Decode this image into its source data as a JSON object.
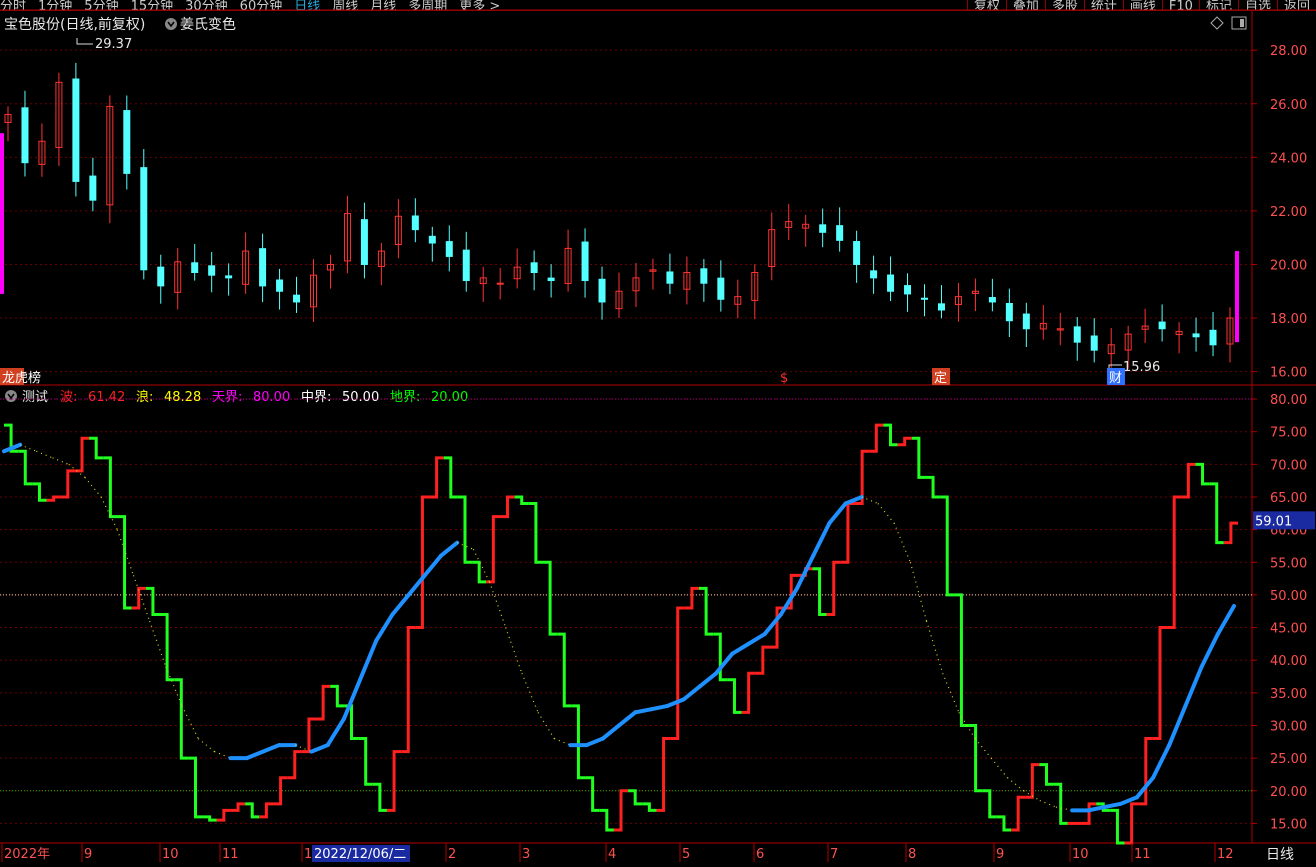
{
  "toolbar": {
    "left_items": [
      "分时",
      "1分钟",
      "5分钟",
      "15分钟",
      "30分钟",
      "60分钟",
      "日线",
      "周线",
      "月线",
      "多周期",
      "更多 >"
    ],
    "active_item": "日线",
    "right_items": [
      "复权",
      "叠加",
      "多股",
      "统计",
      "画线",
      "F10",
      "标记",
      "自选",
      "返回"
    ]
  },
  "price_panel": {
    "title": "宝色股份(日线,前复权)",
    "indicator_name": "姜氏变色",
    "high_label": "29.37",
    "low_label": "15.96",
    "y_ticks": [
      "28.00",
      "26.00",
      "24.00",
      "22.00",
      "20.00",
      "18.00",
      "16.00"
    ],
    "y_values": [
      28,
      26,
      24,
      22,
      20,
      18,
      16
    ],
    "markers": [
      {
        "text": "龙虎榜",
        "color": "#d04020"
      },
      {
        "text": "$",
        "color": "#ff3030"
      },
      {
        "text": "定",
        "color": "#d04020"
      },
      {
        "text": "财",
        "color": "#3070ff"
      }
    ],
    "colors": {
      "up": "#ff3232",
      "down": "#54ffff",
      "accent": "#ff00ff"
    }
  },
  "indicator_panel": {
    "name": "测试",
    "legend": [
      {
        "label": "波:",
        "value": "61.42",
        "color": "#ff2020"
      },
      {
        "label": "浪:",
        "value": "48.28",
        "color": "#ffff00"
      },
      {
        "label": "天界:",
        "value": "80.00",
        "color": "#ff00ff"
      },
      {
        "label": "中界:",
        "value": "50.00",
        "color": "#ffffff"
      },
      {
        "label": "地界:",
        "value": "20.00",
        "color": "#00ff00"
      }
    ],
    "current_value": "59.01",
    "y_ticks": [
      "80.00",
      "75.00",
      "70.00",
      "65.00",
      "60.00",
      "55.00",
      "50.00",
      "45.00",
      "40.00",
      "35.00",
      "30.00",
      "25.00",
      "20.00",
      "15.00"
    ],
    "y_values": [
      80,
      75,
      70,
      65,
      60,
      55,
      50,
      45,
      40,
      35,
      30,
      25,
      20,
      15
    ],
    "level_lines": [
      80,
      50,
      20
    ]
  },
  "x_axis": {
    "labels": [
      "2022年",
      "9",
      "10",
      "11",
      "1",
      "2",
      "3",
      "4",
      "5",
      "6",
      "7",
      "8",
      "9",
      "10",
      "11",
      "12"
    ],
    "cursor_label": "2022/12/06/二",
    "period": "日线"
  },
  "chart_data": [
    {
      "type": "candlestick",
      "title": "宝色股份(日线,前复权)",
      "ylim": [
        15.5,
        29.5
      ],
      "annotations": {
        "high": 29.37,
        "low": 15.96
      },
      "series": [
        {
          "name": "close",
          "values": [
            25.6,
            23.8,
            24.6,
            26.8,
            23.1,
            22.4,
            25.9,
            23.4,
            19.8,
            19.2,
            20.1,
            19.7,
            19.6,
            19.5,
            20.5,
            19.2,
            19.0,
            18.6,
            19.6,
            20.0,
            21.9,
            20.0,
            20.5,
            21.8,
            21.3,
            20.8,
            20.3,
            19.4,
            19.5,
            19.3,
            19.9,
            19.7,
            19.4,
            20.6,
            19.4,
            18.6,
            19.0,
            19.5,
            19.8,
            19.3,
            19.7,
            19.3,
            18.7,
            18.8,
            19.7,
            21.3,
            21.6,
            21.5,
            21.2,
            20.9,
            20.0,
            19.5,
            19.0,
            18.9,
            18.7,
            18.3,
            18.8,
            19.0,
            18.6,
            17.9,
            17.6,
            17.8,
            17.6,
            17.1,
            16.8,
            17.0,
            17.4,
            17.7,
            17.6,
            17.5,
            17.3,
            17.0,
            18.0
          ]
        }
      ]
    },
    {
      "type": "line",
      "title": "测试",
      "ylim": [
        12,
        82
      ],
      "series": [
        {
          "name": "波",
          "values": [
            76,
            72,
            67,
            64.5,
            65,
            69,
            74,
            71,
            62,
            48,
            51,
            47,
            37,
            25,
            16,
            15.5,
            17,
            18,
            16,
            18,
            22,
            26,
            31,
            36,
            33,
            28,
            21,
            17,
            26,
            45,
            65,
            71,
            65,
            55,
            52,
            62,
            65,
            64,
            55,
            44,
            33,
            22,
            17,
            14,
            20,
            18,
            17,
            28,
            48,
            51,
            44,
            37,
            32,
            38,
            42,
            48,
            53,
            54,
            47,
            55,
            64,
            72,
            76,
            73,
            74,
            68,
            65,
            50,
            30,
            20,
            16,
            14,
            19,
            24,
            21,
            15,
            15,
            18,
            17,
            12,
            18,
            28,
            45,
            65,
            70,
            67,
            58,
            61
          ]
        },
        {
          "name": "浪",
          "values": [
            72,
            73,
            72,
            71,
            70,
            68,
            65,
            60,
            53,
            46,
            39,
            33,
            28,
            26,
            25,
            25,
            26,
            27,
            27,
            26,
            27,
            31,
            37,
            43,
            47,
            50,
            53,
            56,
            58,
            57,
            52,
            45,
            38,
            32,
            28,
            27,
            27,
            28,
            30,
            32,
            32.5,
            33,
            34,
            36,
            38,
            41,
            42.5,
            44,
            47,
            51,
            56,
            61,
            64,
            65,
            64,
            61,
            55,
            46,
            38,
            32,
            28,
            25,
            22,
            20,
            18.5,
            17.5,
            17,
            17,
            17.5,
            18,
            19,
            22,
            27,
            33,
            39,
            44,
            48.3
          ]
        }
      ]
    }
  ]
}
